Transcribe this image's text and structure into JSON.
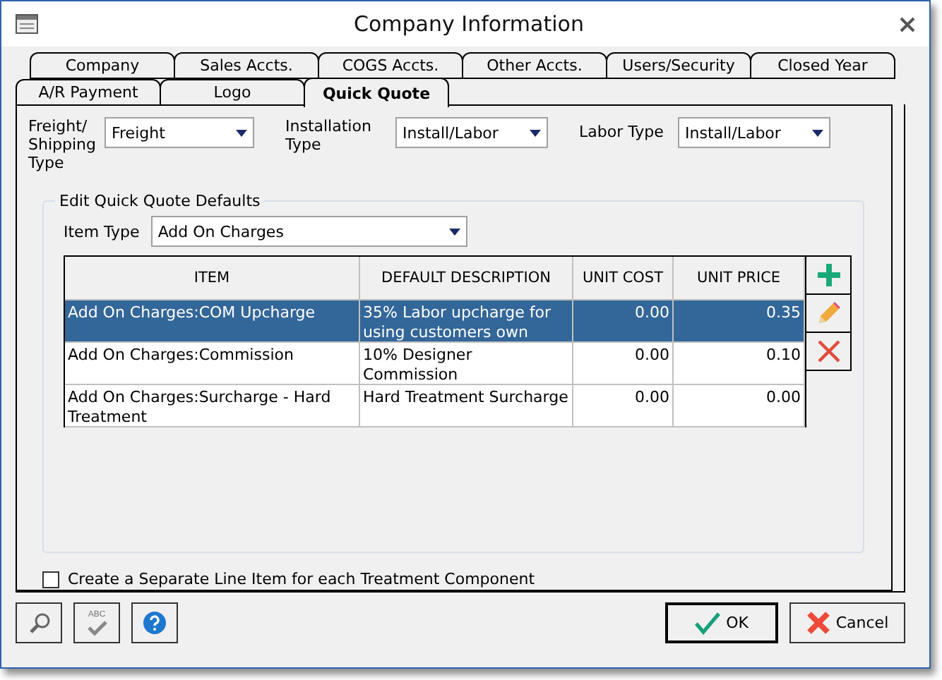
{
  "window": {
    "title": "Company Information"
  },
  "tab_rows": [
    [
      {
        "label": "Company",
        "selected": false
      },
      {
        "label": "Sales Accts.",
        "selected": false
      },
      {
        "label": "COGS Accts.",
        "selected": false
      },
      {
        "label": "Other Accts.",
        "selected": false
      },
      {
        "label": "Users/Security",
        "selected": false
      },
      {
        "label": "Closed Year",
        "selected": false
      }
    ],
    [
      {
        "label": "A/R Payment",
        "selected": false
      },
      {
        "label": "Logo",
        "selected": false
      },
      {
        "label": "Quick Quote",
        "selected": true
      }
    ]
  ],
  "type_fields": [
    {
      "label": "Freight/ Shipping Type",
      "value": "Freight"
    },
    {
      "label": "Installation Type",
      "value": "Install/Labor"
    },
    {
      "label": "Labor Type",
      "value": "Install/Labor"
    }
  ],
  "group": {
    "title": "Edit Quick Quote Defaults",
    "item_type": {
      "label": "Item Type",
      "value": "Add On Charges"
    }
  },
  "table": {
    "columns": [
      "ITEM",
      "DEFAULT DESCRIPTION",
      "UNIT COST",
      "UNIT PRICE"
    ],
    "rows": [
      {
        "selected": true,
        "cells": [
          "Add On Charges:COM Upcharge",
          "35%  Labor upcharge for using customers own",
          "0.00",
          "0.35"
        ]
      },
      {
        "selected": false,
        "cells": [
          "Add On Charges:Commission",
          "10% Designer Commission",
          "0.00",
          "0.10"
        ]
      },
      {
        "selected": false,
        "cells": [
          "Add On Charges:Surcharge - Hard Treatment",
          "Hard Treatment Surcharge",
          "0.00",
          "0.00"
        ]
      }
    ]
  },
  "side_buttons": [
    {
      "kind": "add"
    },
    {
      "kind": "edit"
    },
    {
      "kind": "delete"
    }
  ],
  "separate_line_item": {
    "label": "Create a Separate Line Item for each Treatment Component",
    "checked": false
  },
  "tool_buttons": [
    {
      "kind": "search"
    },
    {
      "kind": "spell",
      "label": "ABC"
    },
    {
      "kind": "help"
    }
  ],
  "buttons": [
    {
      "kind": "ok",
      "label": "OK"
    },
    {
      "kind": "cancel",
      "label": "Cancel"
    }
  ]
}
